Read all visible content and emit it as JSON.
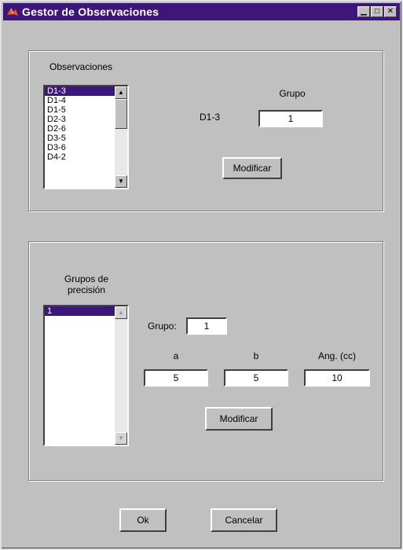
{
  "window": {
    "title": "Gestor de Observaciones"
  },
  "observaciones": {
    "label": "Observaciones",
    "items": [
      "D1-3",
      "D1-4",
      "D1-5",
      "D2-3",
      "D2-6",
      "D3-5",
      "D3-6",
      "D4-2"
    ],
    "selected_index": 0,
    "selected_value": "D1-3",
    "grupo_label": "Grupo",
    "grupo_value": "1",
    "modify_label": "Modificar"
  },
  "precision": {
    "label": "Grupos de\nprecisión",
    "items": [
      "1"
    ],
    "selected_index": 0,
    "grupo_label": "Grupo:",
    "grupo_value": "1",
    "a_label": "a",
    "b_label": "b",
    "ang_label": "Ang. (cc)",
    "a_value": "5",
    "b_value": "5",
    "ang_value": "10",
    "modify_label": "Modificar"
  },
  "footer": {
    "ok_label": "Ok",
    "cancel_label": "Cancelar"
  },
  "colors": {
    "title_bar": "#3d1679",
    "selection": "#3d1679",
    "face": "#c0c0c0"
  },
  "icons": {
    "app": "matlab-logo-icon",
    "minimize": "minimize-icon",
    "maximize": "maximize-icon",
    "close": "close-icon"
  }
}
